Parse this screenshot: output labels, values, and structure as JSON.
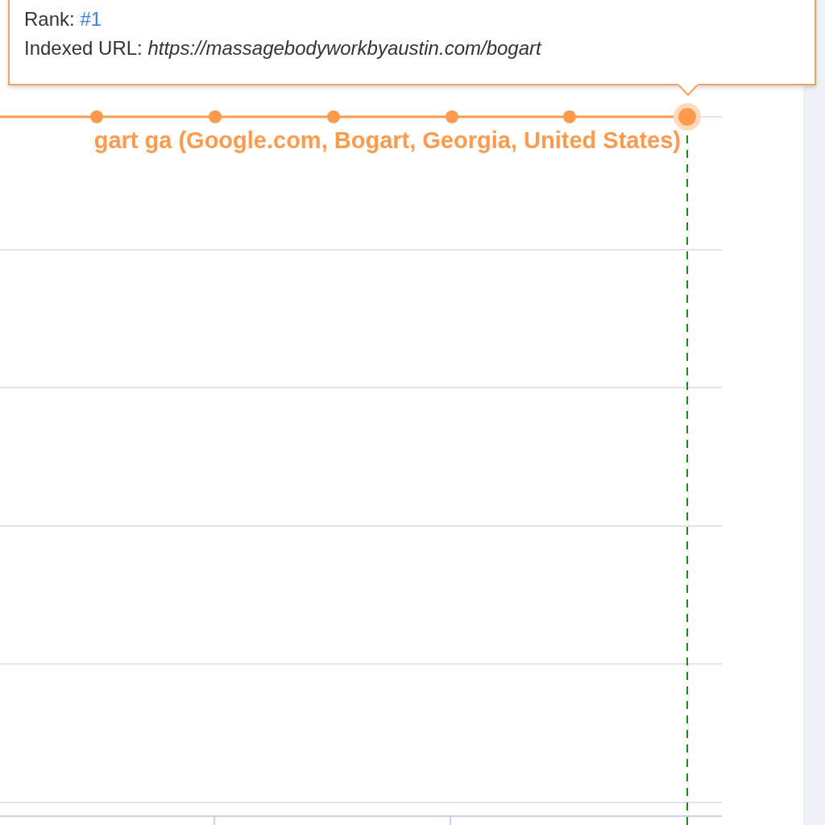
{
  "tooltip": {
    "rank_label": "Rank:",
    "rank_value": "#1",
    "url_label": "Indexed URL:",
    "url_value": "https://massagebodyworkbyaustin.com/bogart"
  },
  "series_label": "gart ga (Google.com, Bogart, Georgia, United States)"
}
